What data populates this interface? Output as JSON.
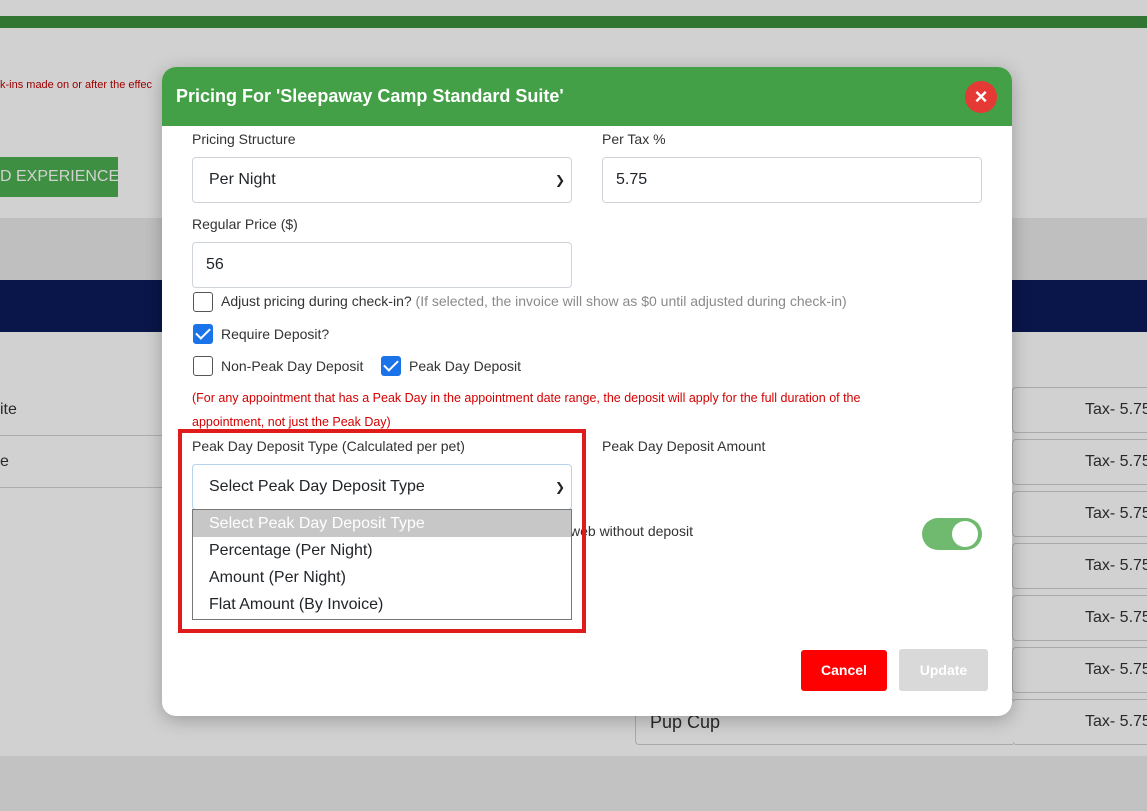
{
  "background": {
    "note_text": "k-ins made on or after the effec",
    "experiences_button": "D EXPERIENCES",
    "left_rows": [
      "ite",
      "e"
    ],
    "right_rows": [
      "Tax- 5.75",
      "Tax- 5.75",
      "Tax- 5.75",
      "Tax- 5.75",
      "Tax- 5.75",
      "Tax- 5.75",
      "Tax- 5.75"
    ],
    "pup_cup": "Pup Cup",
    "colors": {
      "green_bar": "#3e8e3e",
      "navy_band": "#0d1a5a"
    }
  },
  "modal": {
    "title": "Pricing For 'Sleepaway Camp Standard Suite'",
    "close_icon": "×",
    "pricing_structure": {
      "label": "Pricing Structure",
      "value": "Per Night"
    },
    "per_tax": {
      "label": "Per Tax %",
      "value": "5.75"
    },
    "regular_price": {
      "label": "Regular Price ($)",
      "value": "56"
    },
    "adjust_pricing": {
      "label": "Adjust pricing during check-in?",
      "hint": " (If selected, the invoice will show as $0 until adjusted during check-in)",
      "checked": false
    },
    "require_deposit": {
      "label": "Require Deposit?",
      "checked": true
    },
    "non_peak_deposit": {
      "label": "Non-Peak Day Deposit",
      "checked": false
    },
    "peak_deposit": {
      "label": "Peak Day Deposit",
      "checked": true
    },
    "deposit_note_line1": "(For any appointment that has a Peak Day in the appointment date range, the deposit will apply for the full duration of the",
    "deposit_note_line2": "appointment, not just the Peak Day)",
    "peak_deposit_type": {
      "label": "Peak Day Deposit Type (Calculated per pet)",
      "selected": "Select Peak Day Deposit Type",
      "options": [
        "Select Peak Day Deposit Type",
        "Percentage (Per Night)",
        "Amount (Per Night)",
        "Flat Amount (By Invoice)"
      ]
    },
    "peak_deposit_amount_label": "Peak Day Deposit Amount",
    "book_without_deposit_label": "web without deposit",
    "toggle_on": true,
    "cancel_label": "Cancel",
    "update_label": "Update",
    "colors": {
      "header": "#43a047",
      "cancel": "#ff0000",
      "update_disabled": "#d9d9d9",
      "highlight": "#e01b1b"
    }
  }
}
